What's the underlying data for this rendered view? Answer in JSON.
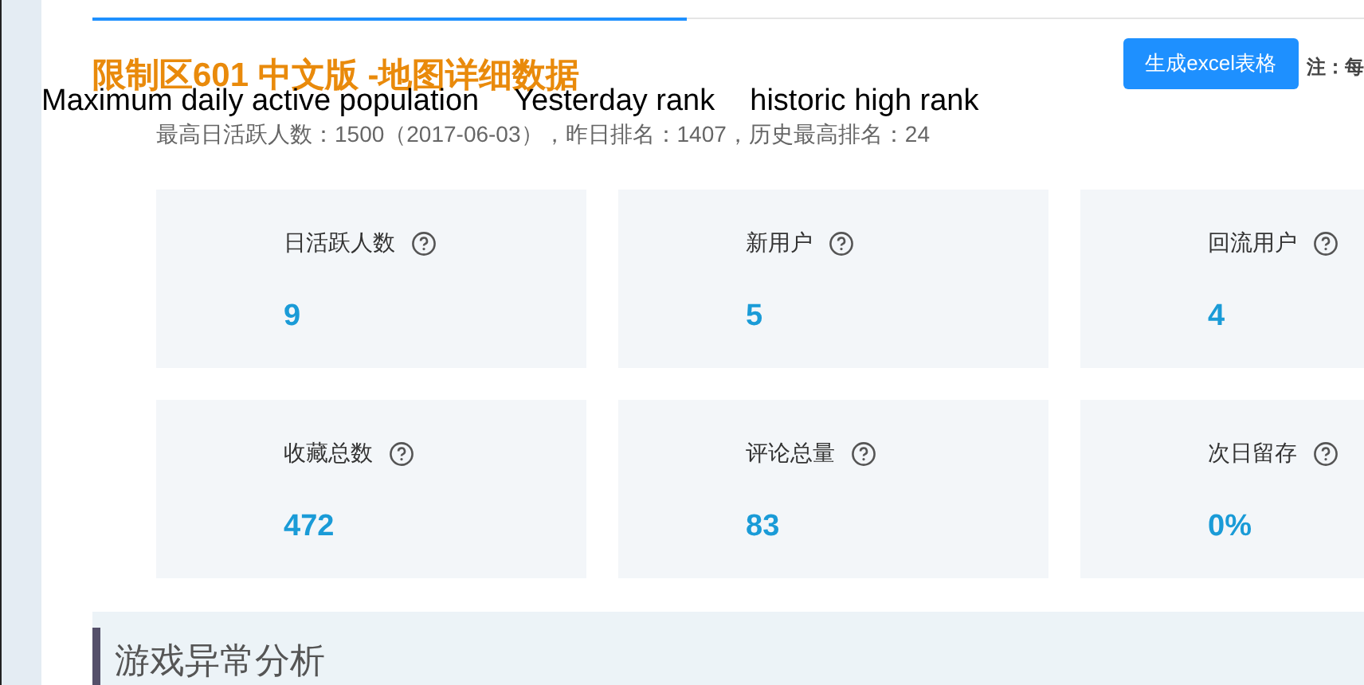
{
  "title": "限制区601 中文版 -地图详细数据",
  "annotations": [
    "Maximum daily active population",
    "Yesterday rank",
    "historic high rank"
  ],
  "summary": "最高日活跃人数：1500（2017-06-03），昨日排名：1407，历史最高排名：24",
  "export_button": "生成excel表格",
  "note": "注：每",
  "stats": [
    {
      "label": "日活跃人数",
      "value": "9"
    },
    {
      "label": "新用户",
      "value": "5"
    },
    {
      "label": "回流用户",
      "value": "4"
    },
    {
      "label": "收藏总数",
      "value": "472"
    },
    {
      "label": "评论总量",
      "value": "83"
    },
    {
      "label": "次日留存",
      "value": "0%"
    }
  ],
  "section_title": "游戏异常分析"
}
